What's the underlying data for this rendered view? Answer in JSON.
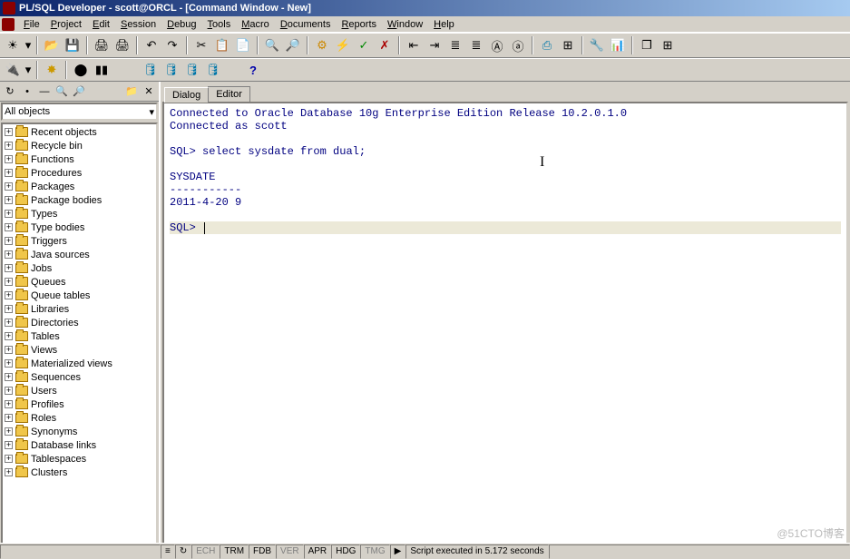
{
  "title": "PL/SQL Developer - scott@ORCL - [Command Window - New]",
  "menus": [
    "File",
    "Project",
    "Edit",
    "Session",
    "Debug",
    "Tools",
    "Macro",
    "Documents",
    "Reports",
    "Window",
    "Help"
  ],
  "combo": {
    "value": "All objects"
  },
  "tree": [
    "Recent objects",
    "Recycle bin",
    "Functions",
    "Procedures",
    "Packages",
    "Package bodies",
    "Types",
    "Type bodies",
    "Triggers",
    "Java sources",
    "Jobs",
    "Queues",
    "Queue tables",
    "Libraries",
    "Directories",
    "Tables",
    "Views",
    "Materialized views",
    "Sequences",
    "Users",
    "Profiles",
    "Roles",
    "Synonyms",
    "Database links",
    "Tablespaces",
    "Clusters"
  ],
  "tabs": {
    "dialog": "Dialog",
    "editor": "Editor"
  },
  "console": {
    "line1": "Connected to Oracle Database 10g Enterprise Edition Release 10.2.0.1.0",
    "line2": "Connected as scott",
    "prompt1": "SQL> ",
    "query": "select sysdate from dual;",
    "heading": "SYSDATE",
    "divider": "-----------",
    "result": "2011-4-20 9",
    "prompt2": "SQL> "
  },
  "status": {
    "cells": [
      "≡",
      "↻",
      "ECH",
      "TRM",
      "FDB",
      "VER",
      "APR",
      "HDG",
      "TMG"
    ],
    "dim": [
      false,
      false,
      true,
      false,
      false,
      true,
      false,
      false,
      true
    ],
    "script": "Script executed in 5.172 seconds"
  },
  "watermark": "@51CTO博客"
}
